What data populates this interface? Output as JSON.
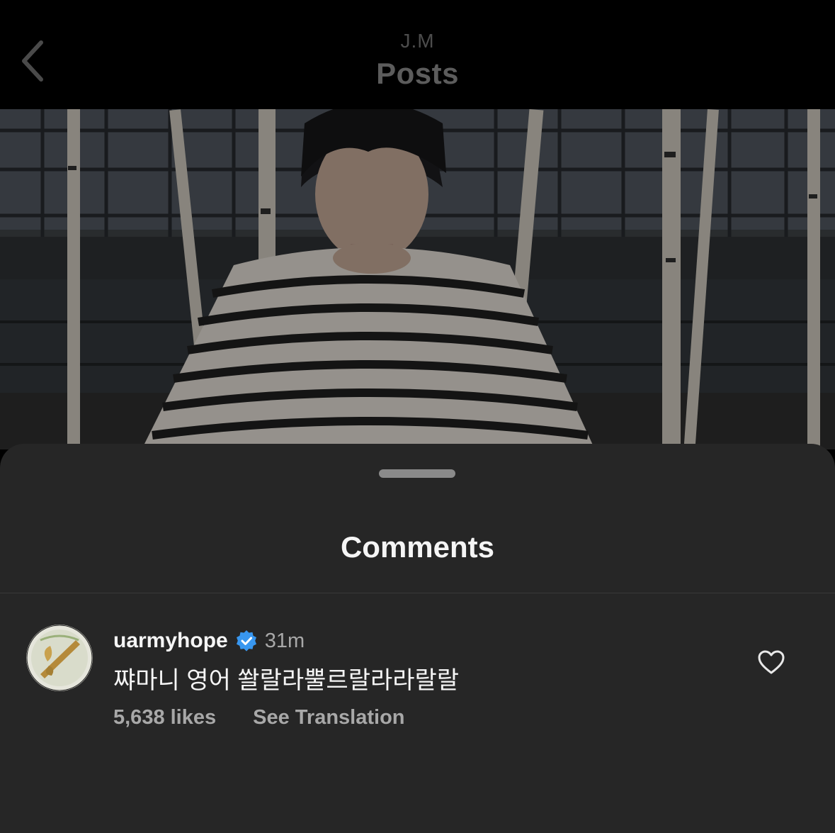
{
  "header": {
    "subtitle": "J.M",
    "title": "Posts"
  },
  "sheet": {
    "title": "Comments"
  },
  "comment": {
    "username": "uarmyhope",
    "time": "31m",
    "text": "쨔마니 영어 쏼랄라뿔르랄라라랄랄",
    "likes": "5,638 likes",
    "see_translation": "See Translation",
    "verified": true
  },
  "icons": {
    "back": "chevron-left-icon",
    "verified": "verified-badge-icon",
    "like": "heart-outline-icon"
  },
  "colors": {
    "header_bg": "#000000",
    "sheet_bg": "#262626",
    "primary_text": "#f5f5f5",
    "secondary_text": "#a8a8a8",
    "verified_blue": "#3897f0"
  }
}
